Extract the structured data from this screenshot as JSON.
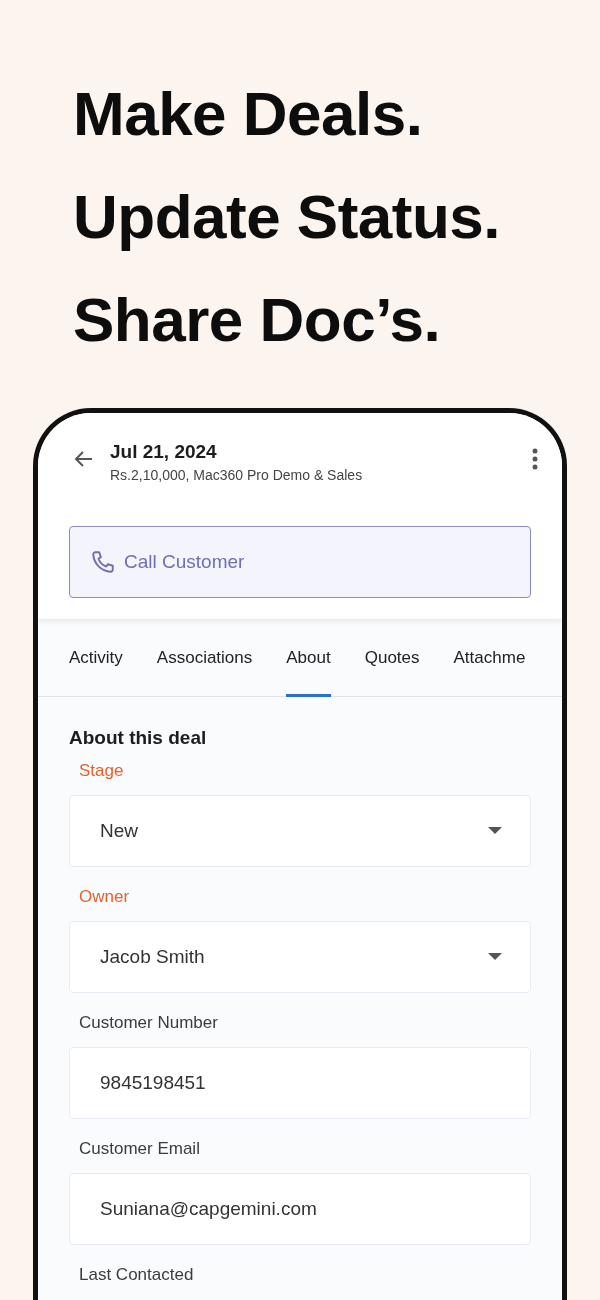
{
  "headline": [
    "Make Deals.",
    "Update Status.",
    "Share Doc’s."
  ],
  "app_bar": {
    "title": "Jul 21, 2024",
    "subtitle": "Rs.2,10,000, Mac360 Pro Demo & Sales"
  },
  "call_button": {
    "label": "Call Customer"
  },
  "tabs": [
    {
      "label": "Activity",
      "selected": false
    },
    {
      "label": "Associations",
      "selected": false
    },
    {
      "label": "About",
      "selected": true
    },
    {
      "label": "Quotes",
      "selected": false
    },
    {
      "label": "Attachme",
      "selected": false
    }
  ],
  "section_title": "About this deal",
  "fields": [
    {
      "label": "Stage",
      "required": true,
      "kind": "select",
      "value": "New"
    },
    {
      "label": "Owner",
      "required": true,
      "kind": "select",
      "value": "Jacob Smith"
    },
    {
      "label": "Customer Number",
      "required": false,
      "kind": "text",
      "value": "9845198451"
    },
    {
      "label": "Customer Email",
      "required": false,
      "kind": "text",
      "value": "Suniana@capgemini.com"
    },
    {
      "label": "Last Contacted",
      "required": false
    }
  ]
}
